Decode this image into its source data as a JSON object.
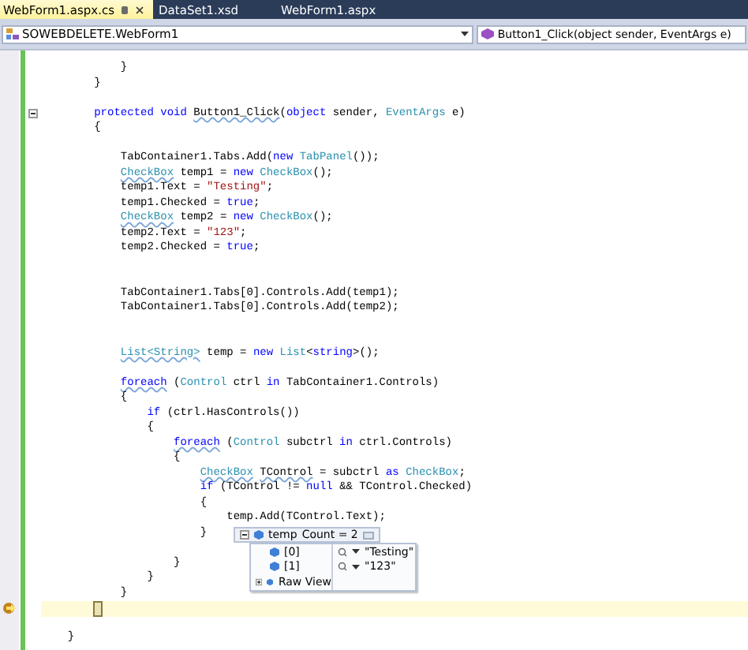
{
  "tabs": [
    {
      "label": "WebForm1.aspx.cs",
      "selected": true
    },
    {
      "label": "DataSet1.xsd",
      "selected": false
    },
    {
      "label": "WebForm1.aspx",
      "selected": false
    }
  ],
  "nav": {
    "class": "SOWEBDELETE.WebForm1",
    "member": "Button1_Click(object sender, EventArgs e)"
  },
  "lines": [
    {
      "current": false,
      "tokens": [
        {
          "t": "            }",
          "kind": "plain"
        }
      ]
    },
    {
      "current": false,
      "tokens": [
        {
          "t": "        }",
          "kind": "plain"
        }
      ]
    },
    {
      "current": false
    },
    {
      "current": false,
      "expanded": true,
      "tokens": [
        {
          "t": "        protected void ",
          "kind": "keyword"
        },
        {
          "t": "Button1_Click",
          "kind": "plain",
          "squiggle": true
        },
        {
          "t": "(",
          "kind": "plain"
        },
        {
          "t": "object",
          "kind": "keyword"
        },
        {
          "t": " sender, ",
          "kind": "plain"
        },
        {
          "t": "EventArgs",
          "kind": "type"
        },
        {
          "t": " e)",
          "kind": "plain"
        }
      ]
    },
    {
      "current": false,
      "tokens": [
        {
          "t": "        {",
          "kind": "plain"
        }
      ]
    },
    {
      "current": false
    },
    {
      "current": false,
      "tokens": [
        {
          "t": "            TabContainer1.Tabs.Add(",
          "kind": "plain"
        },
        {
          "t": "new ",
          "kind": "keyword"
        },
        {
          "t": "TabPanel",
          "kind": "type"
        },
        {
          "t": "());",
          "kind": "plain"
        }
      ]
    },
    {
      "current": false,
      "tokens": [
        {
          "t": "            CheckBox",
          "kind": "type",
          "squiggle": true
        },
        {
          "t": " temp1 = ",
          "kind": "plain"
        },
        {
          "t": "new ",
          "kind": "keyword"
        },
        {
          "t": "CheckBox",
          "kind": "type"
        },
        {
          "t": "();",
          "kind": "plain"
        }
      ]
    },
    {
      "current": false,
      "tokens": [
        {
          "t": "            temp1.Text = ",
          "kind": "plain"
        },
        {
          "t": "\"Testing\"",
          "kind": "string"
        },
        {
          "t": ";",
          "kind": "plain"
        }
      ]
    },
    {
      "current": false,
      "tokens": [
        {
          "t": "            temp1.Checked = ",
          "kind": "plain"
        },
        {
          "t": "true",
          "kind": "keyword"
        },
        {
          "t": ";",
          "kind": "plain"
        }
      ]
    },
    {
      "current": false,
      "tokens": [
        {
          "t": "            CheckBox",
          "kind": "type",
          "squiggle": true
        },
        {
          "t": " temp2 = ",
          "kind": "plain"
        },
        {
          "t": "new ",
          "kind": "keyword"
        },
        {
          "t": "CheckBox",
          "kind": "type"
        },
        {
          "t": "();",
          "kind": "plain"
        }
      ]
    },
    {
      "current": false,
      "tokens": [
        {
          "t": "            temp2.Text = ",
          "kind": "plain"
        },
        {
          "t": "\"123\"",
          "kind": "string"
        },
        {
          "t": ";",
          "kind": "plain"
        }
      ]
    },
    {
      "current": false,
      "tokens": [
        {
          "t": "            temp2.Checked = ",
          "kind": "plain"
        },
        {
          "t": "true",
          "kind": "keyword"
        },
        {
          "t": ";",
          "kind": "plain"
        }
      ]
    },
    {
      "current": false
    },
    {
      "current": false
    },
    {
      "current": false,
      "tokens": [
        {
          "t": "            TabContainer1.Tabs[0].Controls.Add(temp1);",
          "kind": "plain"
        }
      ]
    },
    {
      "current": false,
      "tokens": [
        {
          "t": "            TabContainer1.Tabs[0].Controls.Add(temp2);",
          "kind": "plain"
        }
      ]
    },
    {
      "current": false
    },
    {
      "current": false
    },
    {
      "current": false,
      "tokens": [
        {
          "t": "            List<String>",
          "kind": "type",
          "squiggle": true
        },
        {
          "t": " temp = ",
          "kind": "plain"
        },
        {
          "t": "new ",
          "kind": "keyword"
        },
        {
          "t": "List",
          "kind": "type"
        },
        {
          "t": "<",
          "kind": "plain"
        },
        {
          "t": "string",
          "kind": "keyword"
        },
        {
          "t": ">();",
          "kind": "plain"
        }
      ]
    },
    {
      "current": false
    },
    {
      "current": false,
      "tokens": [
        {
          "t": "            foreach",
          "kind": "keyword",
          "squiggle": true
        },
        {
          "t": " (",
          "kind": "plain"
        },
        {
          "t": "Control",
          "kind": "type"
        },
        {
          "t": " ctrl ",
          "kind": "plain"
        },
        {
          "t": "in",
          "kind": "keyword"
        },
        {
          "t": " TabContainer1.Controls)",
          "kind": "plain"
        }
      ]
    },
    {
      "current": false,
      "tokens": [
        {
          "t": "            {",
          "kind": "plain"
        }
      ]
    },
    {
      "current": false,
      "tokens": [
        {
          "t": "                if",
          "kind": "keyword"
        },
        {
          "t": " (ctrl.HasControls())",
          "kind": "plain"
        }
      ]
    },
    {
      "current": false,
      "tokens": [
        {
          "t": "                {",
          "kind": "plain"
        }
      ]
    },
    {
      "current": false,
      "tokens": [
        {
          "t": "                    foreach",
          "kind": "keyword",
          "squiggle": true
        },
        {
          "t": " (",
          "kind": "plain"
        },
        {
          "t": "Control",
          "kind": "type"
        },
        {
          "t": " subctrl ",
          "kind": "plain"
        },
        {
          "t": "in",
          "kind": "keyword"
        },
        {
          "t": " ctrl.Controls)",
          "kind": "plain"
        }
      ]
    },
    {
      "current": false,
      "tokens": [
        {
          "t": "                    {",
          "kind": "plain"
        }
      ]
    },
    {
      "current": false,
      "tokens": [
        {
          "t": "                        CheckBox",
          "kind": "type",
          "squiggle": true
        },
        {
          "t": " TControl",
          "kind": "plain",
          "squiggle": true
        },
        {
          "t": " = subctrl ",
          "kind": "plain"
        },
        {
          "t": "as ",
          "kind": "keyword"
        },
        {
          "t": "CheckBox",
          "kind": "type"
        },
        {
          "t": ";",
          "kind": "plain"
        }
      ]
    },
    {
      "current": false,
      "tokens": [
        {
          "t": "                        if",
          "kind": "keyword"
        },
        {
          "t": " (TControl != ",
          "kind": "plain"
        },
        {
          "t": "null",
          "kind": "keyword"
        },
        {
          "t": " && TControl.Checked)",
          "kind": "plain"
        }
      ]
    },
    {
      "current": false,
      "tokens": [
        {
          "t": "                        {",
          "kind": "plain"
        }
      ]
    },
    {
      "current": false,
      "tokens": [
        {
          "t": "                            temp.Add(TControl.Text);",
          "kind": "plain"
        }
      ]
    },
    {
      "current": false,
      "tokens": [
        {
          "t": "                        }",
          "kind": "plain"
        }
      ]
    },
    {
      "current": false
    },
    {
      "current": false,
      "tokens": [
        {
          "t": "                    }",
          "kind": "plain"
        }
      ]
    },
    {
      "current": false,
      "tokens": [
        {
          "t": "                }",
          "kind": "plain"
        }
      ]
    },
    {
      "current": false,
      "tokens": [
        {
          "t": "            }",
          "kind": "plain"
        }
      ]
    },
    {
      "current": true
    },
    {
      "current": false
    },
    {
      "current": false,
      "tokens": [
        {
          "t": "    }",
          "kind": "plain"
        }
      ]
    }
  ],
  "datatip": {
    "name": "temp",
    "value": "Count = 2",
    "expanded": true,
    "items": [
      {
        "name": "[0]",
        "value": "\"Testing\"",
        "expandable": false
      },
      {
        "name": "[1]",
        "value": "\"123\"",
        "expandable": false
      },
      {
        "name": "Raw View",
        "expandable": true
      }
    ]
  }
}
